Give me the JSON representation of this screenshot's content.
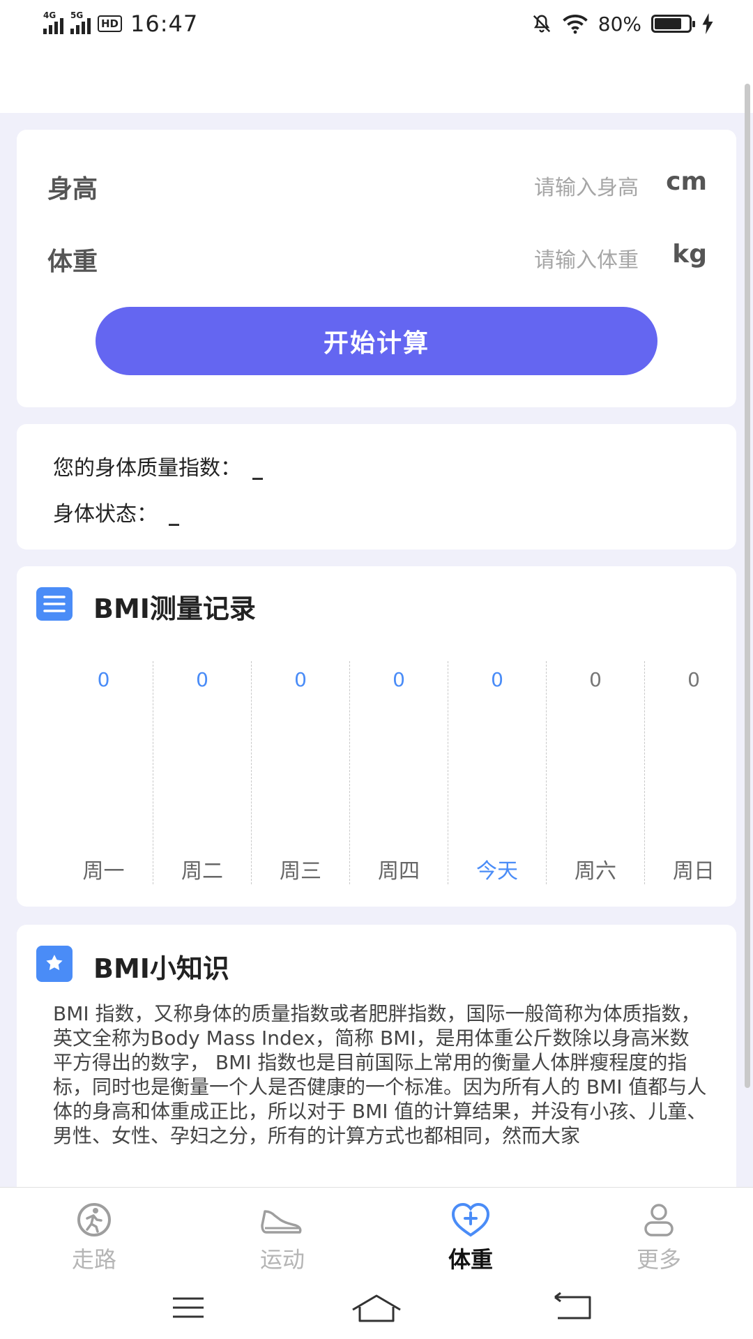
{
  "status_bar": {
    "network1": "4G",
    "network2": "5G",
    "hd": "HD",
    "time": "16:47",
    "battery": "80%",
    "battery_level": 0.8,
    "icons": [
      "mute-icon",
      "wifi-icon",
      "battery-icon",
      "charging-icon"
    ]
  },
  "form": {
    "height_label": "身高",
    "height_placeholder": "请输入身高",
    "height_value": "",
    "height_unit": "cm",
    "weight_label": "体重",
    "weight_placeholder": "请输入体重",
    "weight_value": "",
    "weight_unit": "kg",
    "calc_button": "开始计算"
  },
  "result": {
    "bmi_label": "您的身体质量指数：",
    "bmi_value": "_",
    "status_label": "身体状态：",
    "status_value": "_"
  },
  "record": {
    "title": "BMI测量记录",
    "icon": "list-icon",
    "days": [
      {
        "value": "0",
        "day": "周一"
      },
      {
        "value": "0",
        "day": "周二"
      },
      {
        "value": "0",
        "day": "周三"
      },
      {
        "value": "0",
        "day": "周四"
      },
      {
        "value": "0",
        "day": "今天"
      },
      {
        "value": "0",
        "day": "周六"
      },
      {
        "value": "0",
        "day": "周日"
      }
    ]
  },
  "tips": {
    "title": "BMI小知识",
    "icon": "star-icon",
    "text": "BMI 指数，又称身体的质量指数或者肥胖指数，国际一般简称为体质指数，英文全称为Body Mass Index，简称 BMI，是用体重公斤数除以身高米数平方得出的数字， BMI 指数也是目前国际上常用的衡量人体胖瘦程度的指标，同时也是衡量一个人是否健康的一个标准。因为所有人的 BMI 值都与人体的身高和体重成正比，所以对于 BMI 值的计算结果，并没有小孩、儿童、男性、女性、孕妇之分，所有的计算方式也都相同，然而大家"
  },
  "colors": {
    "accent": "#6466f1",
    "blue": "#4a8cf7",
    "background": "#f0f0fa"
  },
  "tabs": [
    {
      "label": "走路",
      "icon": "walking-icon",
      "active": false
    },
    {
      "label": "运动",
      "icon": "sneaker-icon",
      "active": false
    },
    {
      "label": "体重",
      "icon": "heart-plus-icon",
      "active": true
    },
    {
      "label": "更多",
      "icon": "person-icon",
      "active": false
    }
  ],
  "nav": [
    "menu-icon",
    "home-icon",
    "back-icon"
  ]
}
